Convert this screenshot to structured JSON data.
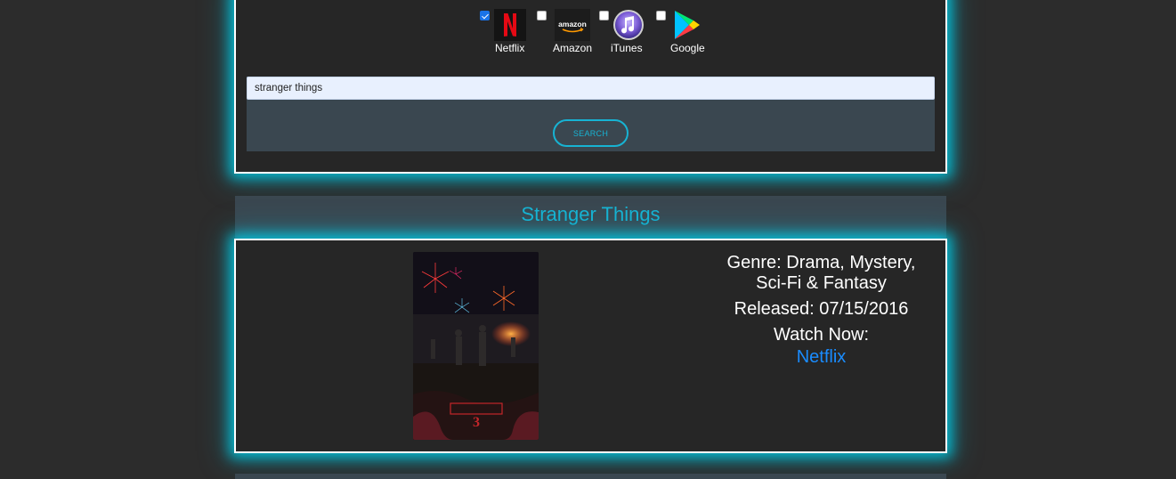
{
  "providers": [
    {
      "label": "Netflix",
      "checked": true,
      "icon": "netflix-icon",
      "color": "#e50914"
    },
    {
      "label": "Amazon",
      "checked": false,
      "icon": "amazon-icon",
      "logo_text": "amazon"
    },
    {
      "label": "iTunes",
      "checked": false,
      "icon": "itunes-icon",
      "color": "#7b5cd6"
    },
    {
      "label": "Google",
      "checked": false,
      "icon": "google-play-icon"
    }
  ],
  "search": {
    "value": "stranger things",
    "button_label": "SEARCH"
  },
  "result": {
    "title": "Stranger Things",
    "genre_line1": "Genre: Drama, Mystery,",
    "genre_line2": "Sci-Fi & Fantasy",
    "released": "Released: 07/15/2016",
    "watch_now": "Watch Now:",
    "watch_link": "Netflix"
  },
  "colors": {
    "accent": "#17b3d3",
    "glow": "#00cde6",
    "link": "#1a8cff",
    "panel": "#3a4750",
    "background": "#2c2c2c"
  }
}
